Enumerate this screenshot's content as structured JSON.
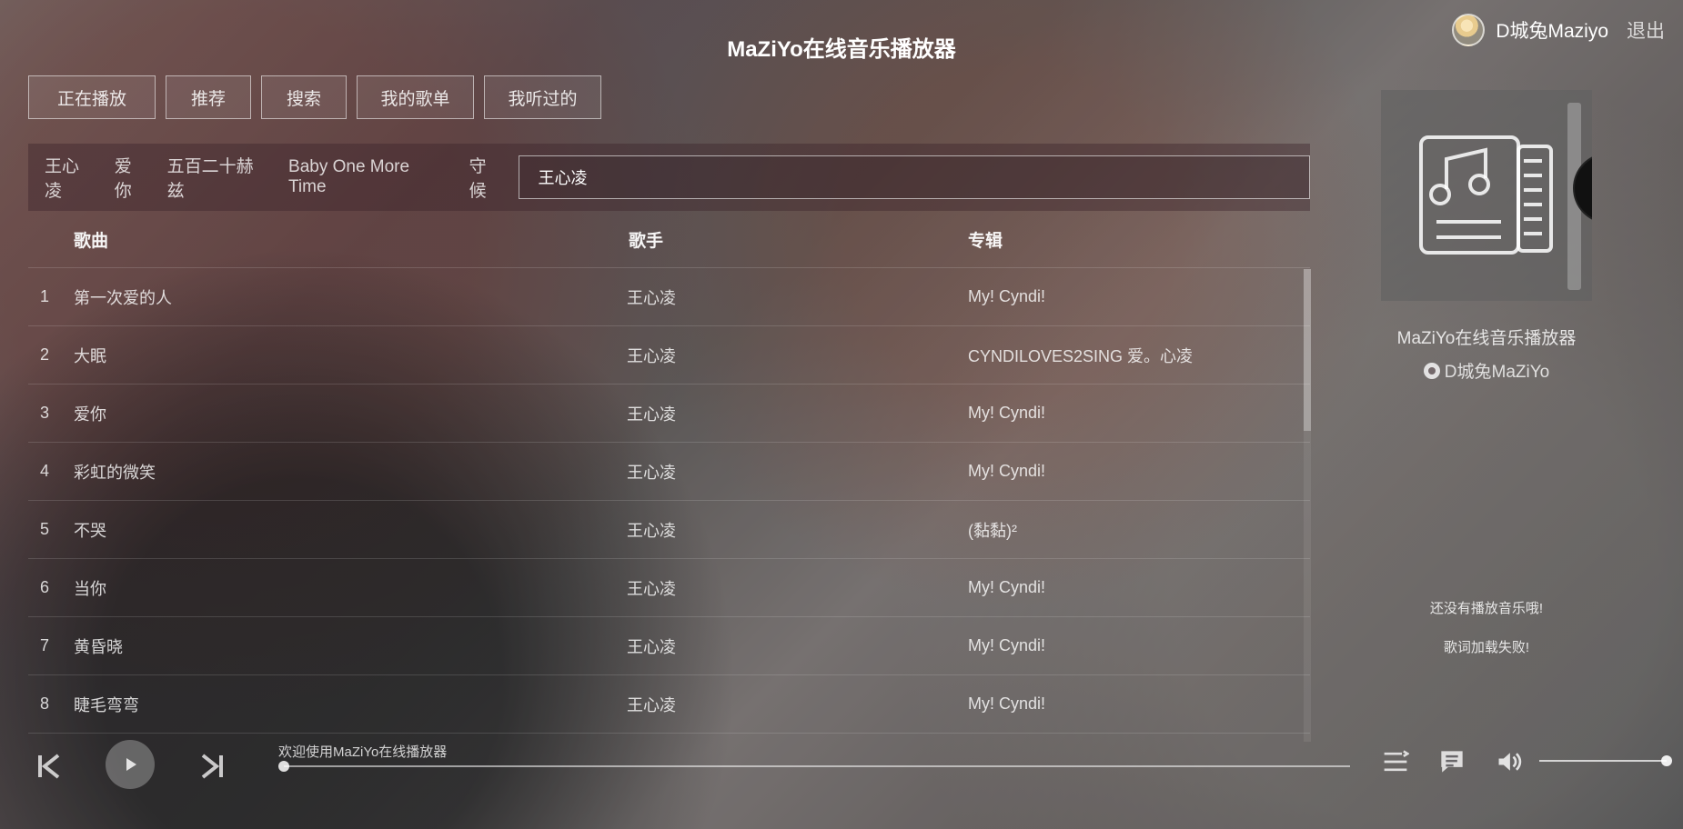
{
  "app": {
    "title": "MaZiYo在线音乐播放器"
  },
  "user": {
    "name": "D城兔Maziyo",
    "logout": "退出"
  },
  "tabs": [
    "正在播放",
    "推荐",
    "搜索",
    "我的歌单",
    "我听过的"
  ],
  "search": {
    "suggestions": [
      "王心凌",
      "爱你",
      "五百二十赫兹",
      "Baby One More Time",
      "守候"
    ],
    "value": "王心凌"
  },
  "table": {
    "headers": {
      "song": "歌曲",
      "artist": "歌手",
      "album": "专辑"
    },
    "rows": [
      {
        "number": "1",
        "song": "第一次爱的人",
        "artist": "王心凌",
        "album": "My! Cyndi!"
      },
      {
        "number": "2",
        "song": "大眠",
        "artist": "王心凌",
        "album": "CYNDILOVES2SING 爱。心凌"
      },
      {
        "number": "3",
        "song": "爱你",
        "artist": "王心凌",
        "album": "My! Cyndi!"
      },
      {
        "number": "4",
        "song": "彩虹的微笑",
        "artist": "王心凌",
        "album": "My! Cyndi!"
      },
      {
        "number": "5",
        "song": "不哭",
        "artist": "王心凌",
        "album": "(黏黏)²"
      },
      {
        "number": "6",
        "song": "当你",
        "artist": "王心凌",
        "album": "My! Cyndi!"
      },
      {
        "number": "7",
        "song": "黄昏晓",
        "artist": "王心凌",
        "album": "My! Cyndi!"
      },
      {
        "number": "8",
        "song": "睫毛弯弯",
        "artist": "王心凌",
        "album": "My! Cyndi!"
      }
    ]
  },
  "side_panel": {
    "title": "MaZiYo在线音乐播放器",
    "github": "D城兔MaZiYo",
    "no_music": "还没有播放音乐哦!",
    "lyrics_error": "歌词加载失败!"
  },
  "player": {
    "status": "欢迎使用MaZiYo在线播放器",
    "progress": 0,
    "volume": 1
  },
  "icons": {
    "previous": "previous-icon",
    "play": "play-icon",
    "next": "next-icon",
    "playlist": "playlist-icon",
    "lyrics": "lyrics-icon",
    "volume": "volume-icon",
    "album": "music-document-icon",
    "github": "github-icon"
  },
  "colors": {
    "text": "#ffffff",
    "muted_text": "#d8d2d2",
    "panel": "#606060"
  }
}
